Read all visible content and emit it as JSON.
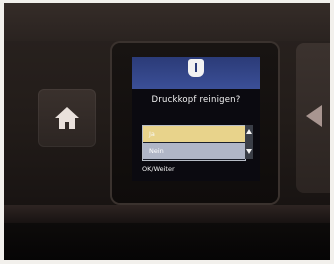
{
  "device": {
    "dialog": {
      "title": "Druckkopf reinigen?",
      "options": [
        "Ja",
        "Nein"
      ],
      "selected_option": "Ja",
      "footer": "OK/Weiter"
    },
    "icons": {
      "info": "info-icon",
      "home": "home-icon",
      "back": "back-arrow-icon",
      "scroll_up": "chevron-up-icon",
      "scroll_down": "chevron-down-icon"
    }
  }
}
